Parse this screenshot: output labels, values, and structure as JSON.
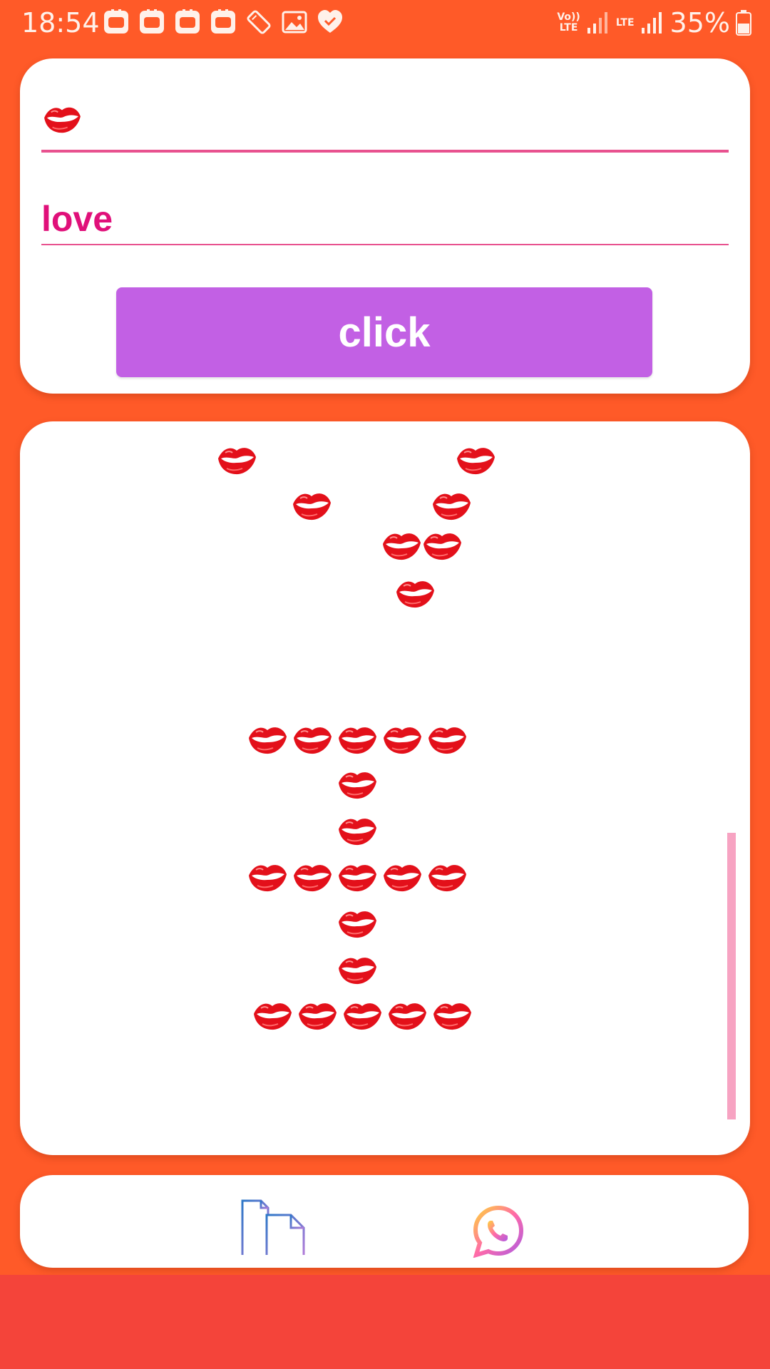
{
  "status_bar": {
    "time": "18:54",
    "network_1": "Vo))\nLTE",
    "network_2": "LTE",
    "battery": "35%",
    "left_icons": [
      "notification-app-icon",
      "notification-app-icon",
      "notification-app-icon",
      "notification-app-icon",
      "screen-rotation-icon",
      "image-icon",
      "heart-check-icon"
    ]
  },
  "form": {
    "symbol_value": "💋",
    "text_value": "love",
    "button_label": "click"
  },
  "output": {
    "symbol": "kiss-lips-icon",
    "text_rendered": "YI"
  },
  "bottom_bar": {
    "icons": [
      "documents-icon",
      "whatsapp-icon"
    ]
  },
  "colors": {
    "background": "#FF5A28",
    "accent_pink": "#E8528F",
    "text_pink": "#E0107A",
    "button": "#C260E4",
    "bottom_strip": "#F4443A",
    "scrollbar": "#F7A3C2"
  }
}
